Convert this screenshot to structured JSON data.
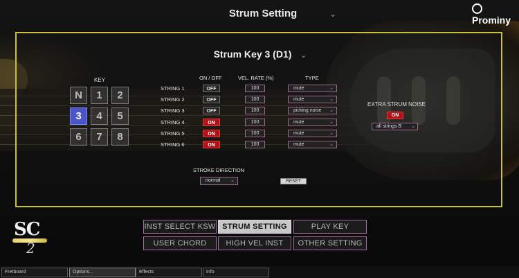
{
  "header": {
    "title": "Strum Setting",
    "brand": "Prominy"
  },
  "panel": {
    "title": "Strum Key 3 (D1)"
  },
  "key": {
    "label": "KEY",
    "buttons": [
      "N",
      "1",
      "2",
      "3",
      "4",
      "5",
      "6",
      "7",
      "8"
    ],
    "active": "3"
  },
  "columns": {
    "onoff": "ON / OFF",
    "vel_rate": "VEL. RATE (%)",
    "type": "TYPE"
  },
  "strings": [
    {
      "label": "STRING 1",
      "onoff": "OFF",
      "vel": "100",
      "type": "mute"
    },
    {
      "label": "STRING 2",
      "onoff": "OFF",
      "vel": "100",
      "type": "mute"
    },
    {
      "label": "STRING 3",
      "onoff": "OFF",
      "vel": "100",
      "type": "picking noise"
    },
    {
      "label": "STRING 4",
      "onoff": "ON",
      "vel": "100",
      "type": "mute"
    },
    {
      "label": "STRING 5",
      "onoff": "ON",
      "vel": "100",
      "type": "mute"
    },
    {
      "label": "STRING 6",
      "onoff": "ON",
      "vel": "100",
      "type": "mute"
    }
  ],
  "extra_noise": {
    "label": "EXTRA STRUM NOISE",
    "state": "ON",
    "selection": "all strings B"
  },
  "stroke": {
    "label": "STROKE DIRECTION",
    "value": "normal",
    "reset_label": "RESET"
  },
  "logo": {
    "letters": "SC",
    "number": "2"
  },
  "nav": [
    {
      "label": "INST SELECT KSW",
      "active": false
    },
    {
      "label": "STRUM SETTING",
      "active": true
    },
    {
      "label": "PLAY KEY",
      "active": false
    },
    {
      "label": "USER CHORD",
      "active": false
    },
    {
      "label": "HIGH VEL INST",
      "active": false
    },
    {
      "label": "OTHER SETTING",
      "active": false
    }
  ],
  "tabs": [
    "Fretboard",
    "Options...",
    "Effects",
    "Info"
  ],
  "active_tab": "Options...",
  "colors": {
    "panel_border": "#c9c23a",
    "on_red": "#b01218",
    "key_active": "#4a55c8",
    "field_border": "#9a6a90"
  }
}
